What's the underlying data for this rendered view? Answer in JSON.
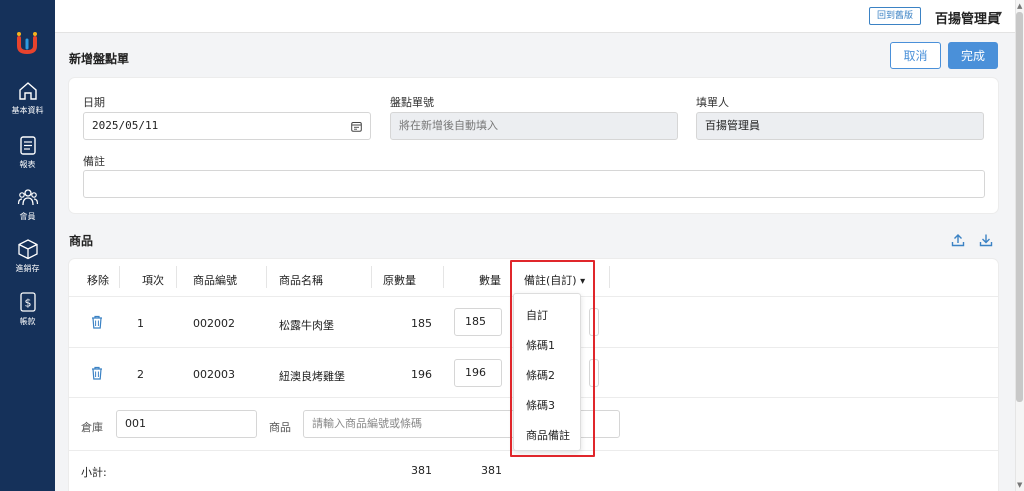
{
  "header": {
    "old_version_button": "回到舊版",
    "user_name": "百揚管理員",
    "user_caret": "▾"
  },
  "sidebar": {
    "items": [
      {
        "label": "基本資料",
        "icon": "home-icon"
      },
      {
        "label": "報表",
        "icon": "document-icon"
      },
      {
        "label": "會員",
        "icon": "members-icon"
      },
      {
        "label": "進銷存",
        "icon": "box-icon"
      },
      {
        "label": "帳款",
        "icon": "dollar-icon"
      }
    ]
  },
  "page": {
    "title": "新增盤點單",
    "cancel_label": "取消",
    "done_label": "完成"
  },
  "form": {
    "date_label": "日期",
    "date_value": "2025/05/11",
    "number_label": "盤點單號",
    "number_placeholder": "將在新增後自動填入",
    "filler_label": "填單人",
    "filler_value": "百揚管理員",
    "note_label": "備註",
    "note_value": ""
  },
  "products": {
    "section_title": "商品",
    "columns": {
      "remove": "移除",
      "index": "項次",
      "code": "商品編號",
      "name": "商品名稱",
      "original_qty": "原數量",
      "qty": "數量",
      "note": "備註(自訂)",
      "note_caret": "▾"
    },
    "rows": [
      {
        "index": "1",
        "code": "002002",
        "name": "松露牛肉堡",
        "original_qty": "185",
        "qty": "185"
      },
      {
        "index": "2",
        "code": "002003",
        "name": "紐澳良烤雞堡",
        "original_qty": "196",
        "qty": "196"
      }
    ],
    "warehouse_label": "倉庫",
    "warehouse_value": "001",
    "product_label": "商品",
    "product_placeholder": "請輸入商品編號或條碼",
    "subtotal_label": "小計:",
    "subtotal_original": "381",
    "subtotal_qty": "381"
  },
  "note_dropdown": {
    "options": [
      "自訂",
      "條碼1",
      "條碼2",
      "條碼3",
      "商品備註"
    ]
  },
  "colors": {
    "sidebar": "#15315a",
    "primary": "#4a90d9",
    "highlight": "#e0262b"
  }
}
